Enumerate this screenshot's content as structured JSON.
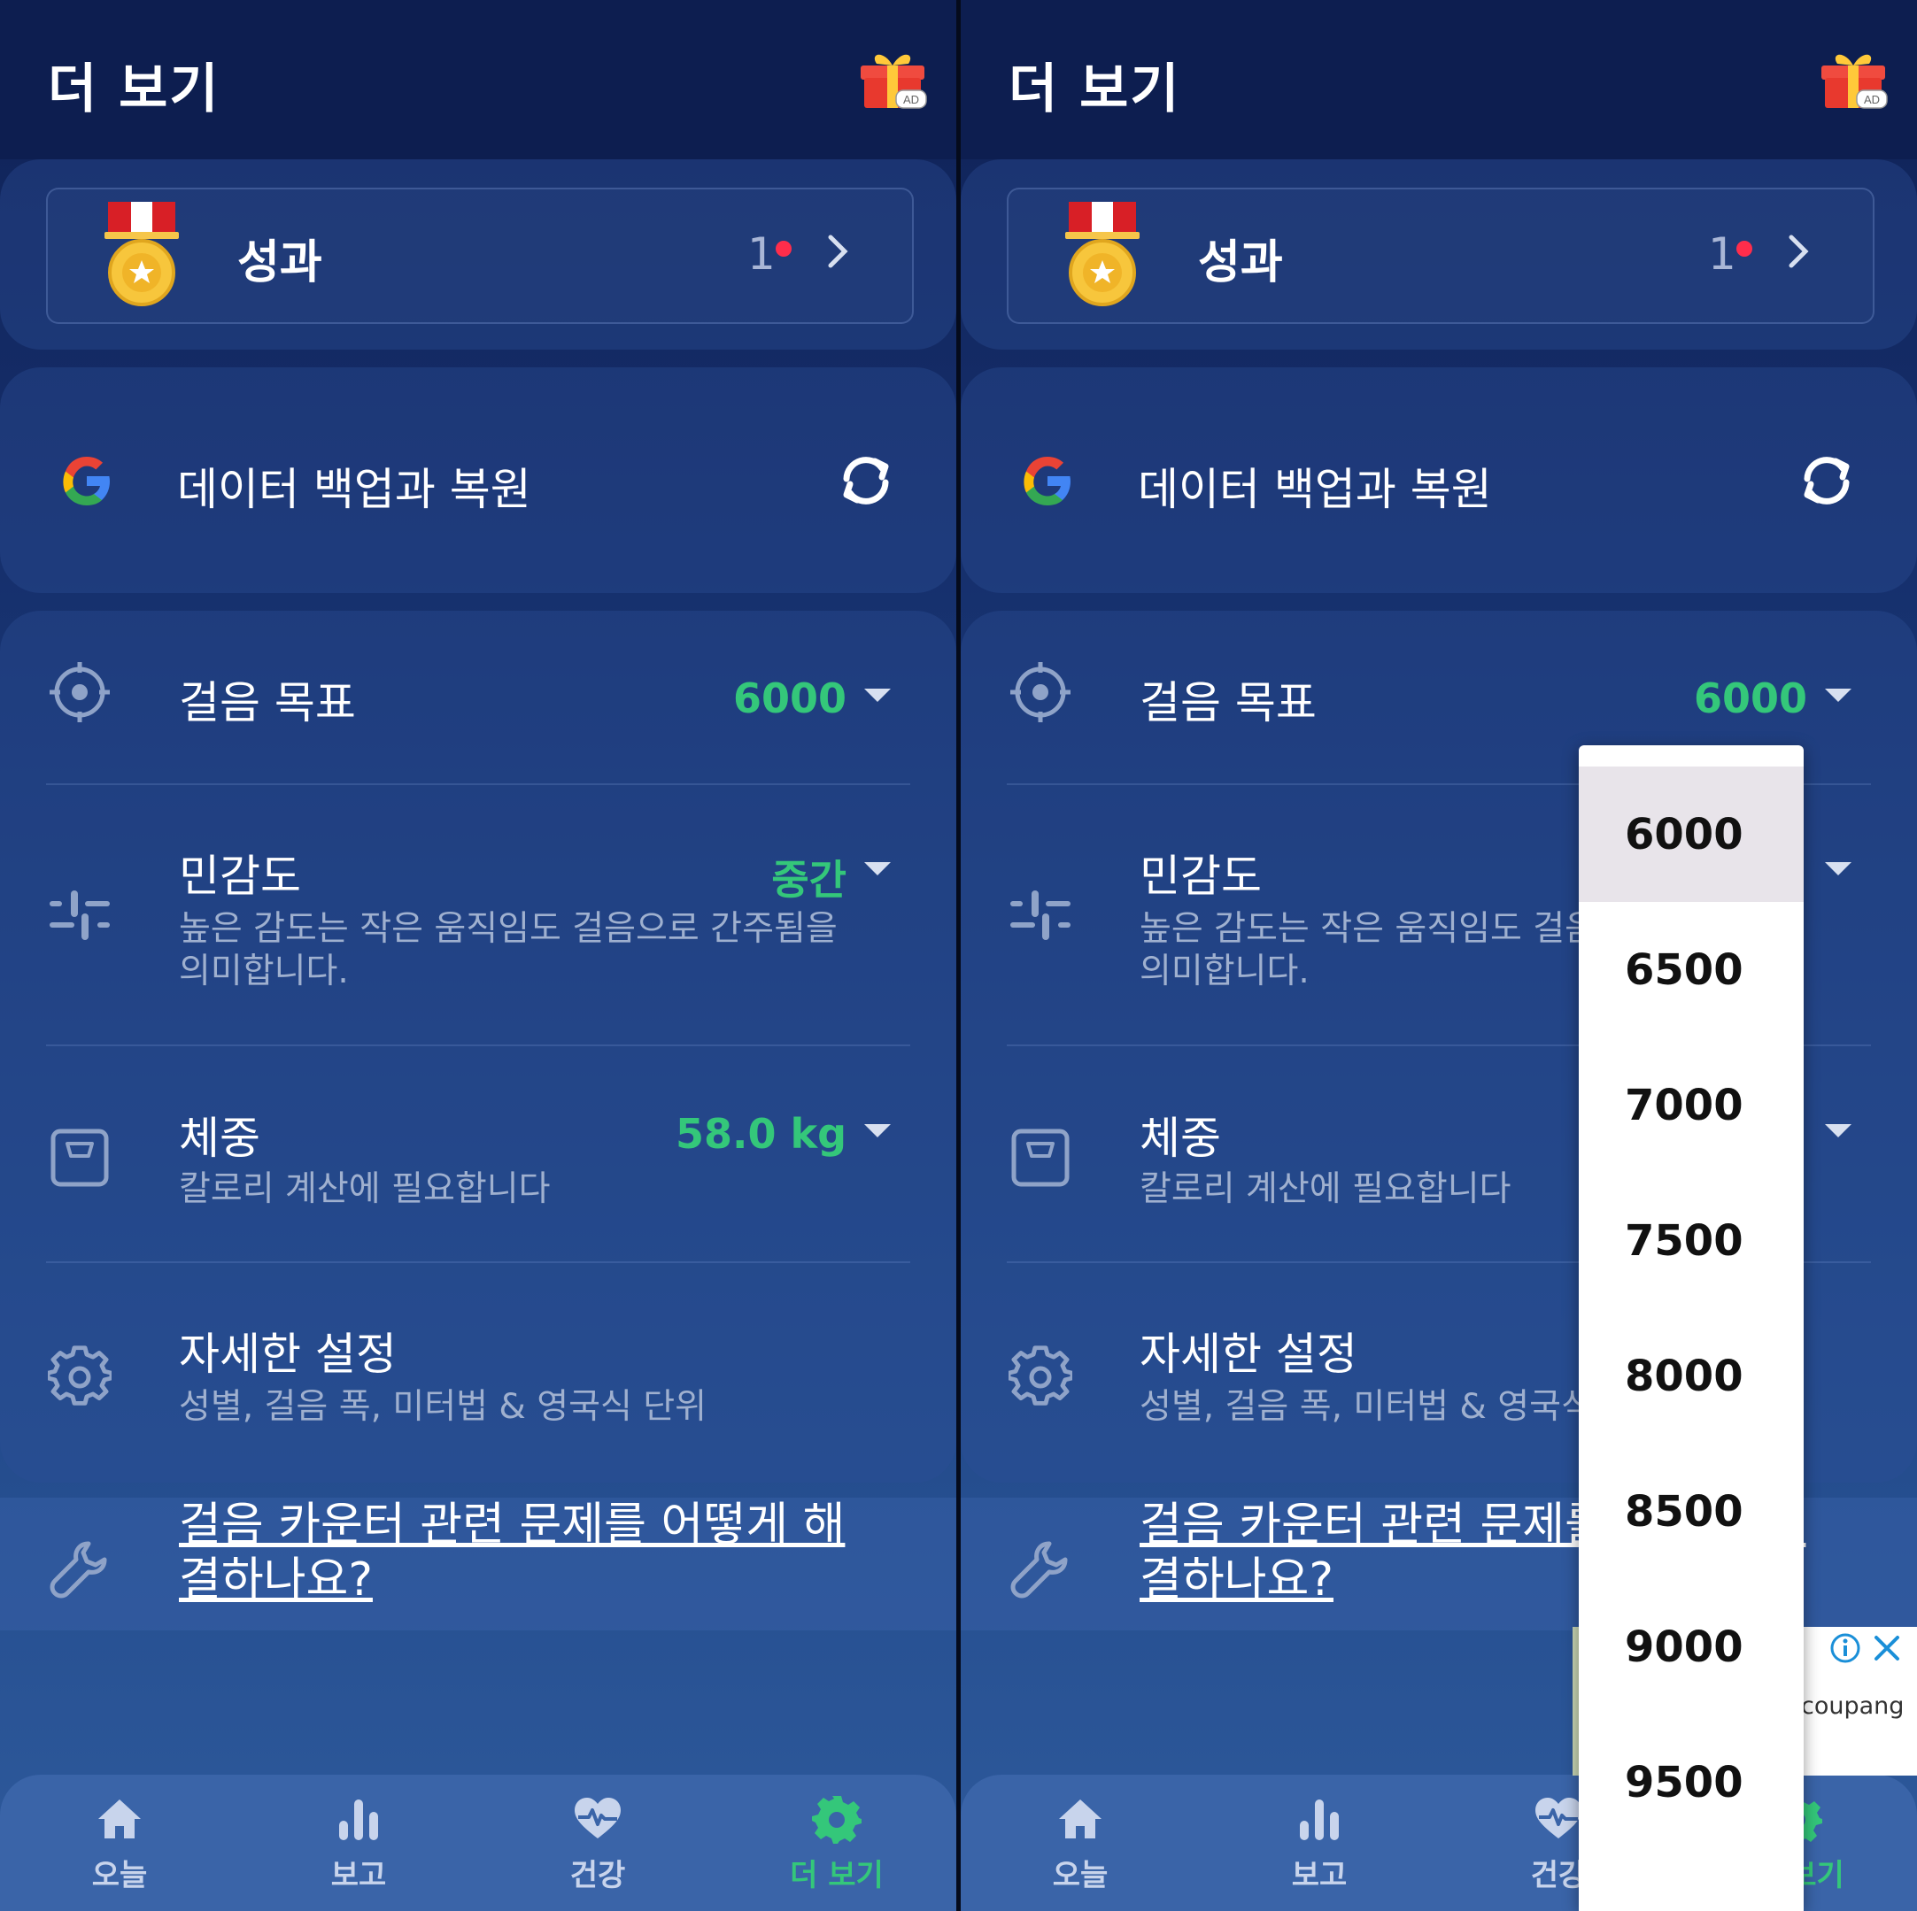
{
  "header": {
    "title": "더 보기",
    "ad_badge": "AD"
  },
  "achievements": {
    "label": "성과",
    "count": "1"
  },
  "backup": {
    "label": "데이터 백업과 복원"
  },
  "settings": {
    "step_goal": {
      "title": "걸음 목표",
      "value": "6000"
    },
    "sensitivity": {
      "title": "민감도",
      "value": "중간",
      "description": "높은 감도는 작은 움직임도 걸음으로 간주됨을 의미합니다."
    },
    "weight": {
      "title": "체중",
      "value": "58.0 kg",
      "description": "칼로리 계산에 필요합니다"
    },
    "advanced": {
      "title": "자세한 설정",
      "description": "성별, 걸음 폭, 미터법 & 영국식 단위"
    }
  },
  "help": {
    "text": "걸음 카운터 관련 문제를 어떻게 해결하나요?"
  },
  "nav": {
    "items": [
      {
        "label": "오늘",
        "icon": "home-icon"
      },
      {
        "label": "보고",
        "icon": "bar-chart-icon"
      },
      {
        "label": "건강",
        "icon": "heart-pulse-icon"
      },
      {
        "label": "더 보기",
        "icon": "gear-icon",
        "active": true
      }
    ]
  },
  "step_goal_dropdown": {
    "selected": "6000",
    "options": [
      "6000",
      "6500",
      "7000",
      "7500",
      "8000",
      "8500",
      "9000",
      "9500"
    ]
  },
  "ad_banner": {
    "brand": "coupang"
  },
  "colors": {
    "accent_green": "#34c77a",
    "header_bg": "#0d1e50",
    "nav_bg": "#3a64a8",
    "badge_red": "#ff2d4b"
  }
}
